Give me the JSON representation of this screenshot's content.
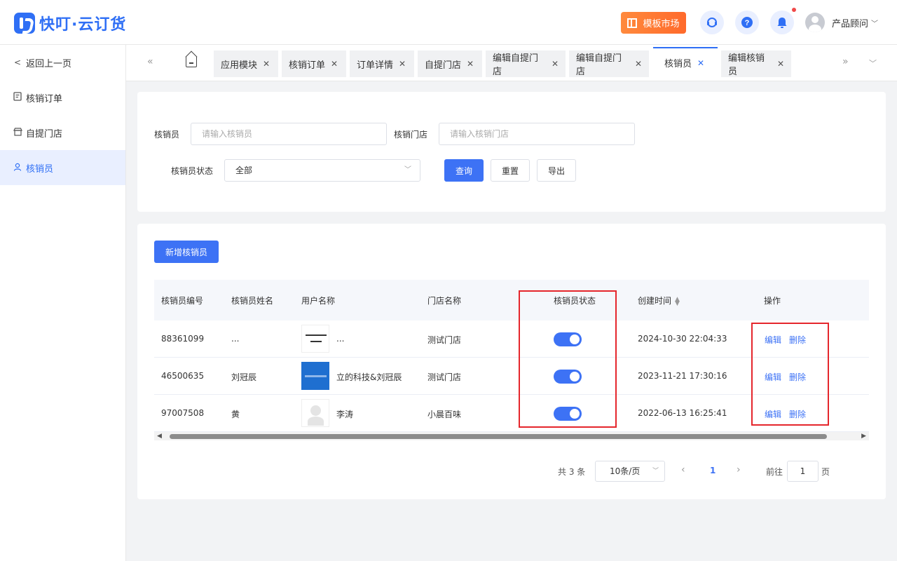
{
  "header": {
    "app_name": "快叮·云订货",
    "market_label": "模板市场",
    "user_name": "产品顾问"
  },
  "sidebar": {
    "back_label": "返回上一页",
    "items": [
      {
        "label": "核销订单",
        "icon": "order-icon"
      },
      {
        "label": "自提门店",
        "icon": "store-icon"
      },
      {
        "label": "核销员",
        "icon": "user-icon",
        "active": true
      }
    ]
  },
  "tabs": [
    {
      "label": "应用模块"
    },
    {
      "label": "核销订单"
    },
    {
      "label": "订单详情"
    },
    {
      "label": "自提门店"
    },
    {
      "label": "编辑自提门店"
    },
    {
      "label": "编辑自提门店"
    },
    {
      "label": "核销员",
      "active": true
    },
    {
      "label": "编辑核销员"
    }
  ],
  "filters": {
    "verifier_label": "核销员",
    "verifier_placeholder": "请输入核销员",
    "store_label": "核销门店",
    "store_placeholder": "请输入核销门店",
    "status_label": "核销员状态",
    "status_value": "全部",
    "query_btn": "查询",
    "reset_btn": "重置",
    "export_btn": "导出"
  },
  "table": {
    "add_btn": "新增核销员",
    "columns": [
      "核销员编号",
      "核销员姓名",
      "用户名称",
      "门店名称",
      "核销员状态",
      "创建时间",
      "操作"
    ],
    "rows": [
      {
        "id": "88361099",
        "name": "...",
        "user": "...",
        "store": "测试门店",
        "enabled": true,
        "created": "2024-10-30 22:04:33"
      },
      {
        "id": "46500635",
        "name": "刘冠辰",
        "user": "立的科技&刘冠辰",
        "store": "测试门店",
        "enabled": true,
        "created": "2023-11-21 17:30:16"
      },
      {
        "id": "97007508",
        "name": "黄",
        "user": "李涛",
        "store": "小晨百味",
        "enabled": true,
        "created": "2022-06-13 16:25:41"
      }
    ],
    "edit_label": "编辑",
    "delete_label": "删除"
  },
  "pagination": {
    "total": "共 3 条",
    "page_size": "10条/页",
    "current": "1",
    "goto_label": "前往",
    "goto_value": "1",
    "page_suffix": "页"
  },
  "colors": {
    "primary": "#3d72f5",
    "highlight": "#e5262c",
    "market_orange": "#ff7a33"
  }
}
